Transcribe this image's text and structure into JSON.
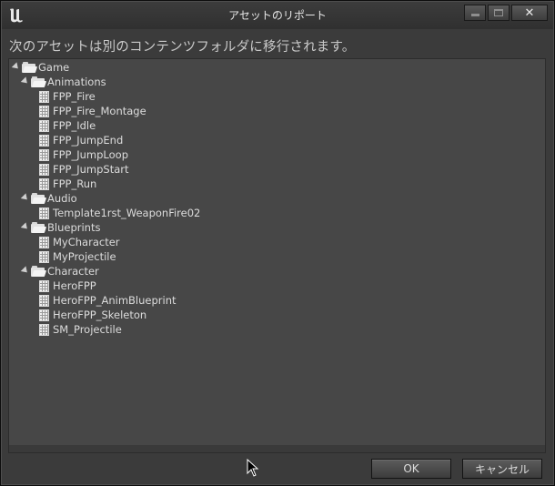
{
  "window": {
    "title": "アセットのリポート",
    "logo_icon": "unreal-engine-logo",
    "controls": {
      "minimize": "minimize-icon",
      "maximize": "maximize-icon",
      "close": "✕"
    }
  },
  "message": "次のアセットは別のコンテンツフォルダに移行されます。",
  "tree": {
    "root": "Game",
    "folders": [
      {
        "label": "Animations",
        "items": [
          "FPP_Fire",
          "FPP_Fire_Montage",
          "FPP_Idle",
          "FPP_JumpEnd",
          "FPP_JumpLoop",
          "FPP_JumpStart",
          "FPP_Run"
        ]
      },
      {
        "label": "Audio",
        "items": [
          "Template1rst_WeaponFire02"
        ]
      },
      {
        "label": "Blueprints",
        "items": [
          "MyCharacter",
          "MyProjectile"
        ]
      },
      {
        "label": "Character",
        "items": [
          "HeroFPP",
          "HeroFPP_AnimBlueprint",
          "HeroFPP_Skeleton",
          "SM_Projectile"
        ]
      }
    ]
  },
  "buttons": {
    "ok": "OK",
    "cancel": "キャンセル"
  },
  "colors": {
    "background": "#3b3b3b",
    "panel": "#474747",
    "text": "#dcdcdc"
  }
}
